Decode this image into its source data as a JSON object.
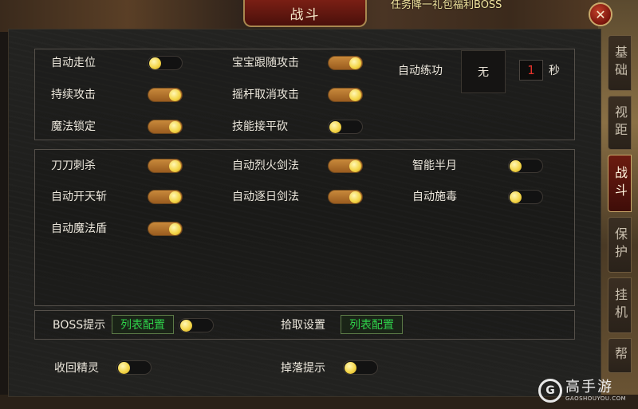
{
  "window": {
    "title": "战斗",
    "background_marquee": "任务降一礼包福利BOSS",
    "close_symbol": "✕"
  },
  "tabs": [
    {
      "label": "基础",
      "active": false
    },
    {
      "label": "视距",
      "active": false
    },
    {
      "label": "战斗",
      "active": true
    },
    {
      "label": "保护",
      "active": false
    },
    {
      "label": "挂机",
      "active": false
    },
    {
      "label": "帮",
      "active": false
    }
  ],
  "group1": {
    "auto_walk": {
      "label": "自动走位",
      "on": false
    },
    "continuous_attack": {
      "label": "持续攻击",
      "on": true
    },
    "magic_lock": {
      "label": "魔法锁定",
      "on": true
    },
    "pet_follow_attack": {
      "label": "宝宝跟随攻击",
      "on": true
    },
    "joystick_cancel_attack": {
      "label": "摇杆取消攻击",
      "on": true
    },
    "skill_flat_chop": {
      "label": "技能接平砍",
      "on": false
    },
    "auto_practice": {
      "label": "自动练功",
      "skill_value": "无",
      "seconds": "1",
      "unit": "秒"
    }
  },
  "group2": {
    "sword_stab": {
      "label": "刀刀刺杀",
      "on": true
    },
    "auto_sky_slash": {
      "label": "自动开天斩",
      "on": true
    },
    "auto_magic_shield": {
      "label": "自动魔法盾",
      "on": true
    },
    "auto_fire_sword": {
      "label": "自动烈火剑法",
      "on": true
    },
    "auto_sun_sword": {
      "label": "自动逐日剑法",
      "on": true
    },
    "smart_half_moon": {
      "label": "智能半月",
      "on": false
    },
    "auto_poison": {
      "label": "自动施毒",
      "on": false
    }
  },
  "group3": {
    "boss_alert": {
      "label": "BOSS提示",
      "config_label": "列表配置",
      "on": false
    },
    "pickup_settings": {
      "label": "拾取设置",
      "config_label": "列表配置"
    }
  },
  "footer": {
    "recall_spirit": {
      "label": "收回精灵",
      "on": false
    },
    "drop_alert": {
      "label": "掉落提示",
      "on": false
    }
  },
  "watermark": {
    "logo_letter": "G",
    "cn": "高手游",
    "en": "GAOSHOUYOU.COM"
  },
  "colors": {
    "toggle_on": "#c8893b",
    "knob": "#f4d64a",
    "config_text": "#2fd14a",
    "seconds_text": "#e3322a",
    "title_plate": "#7a1f14"
  }
}
